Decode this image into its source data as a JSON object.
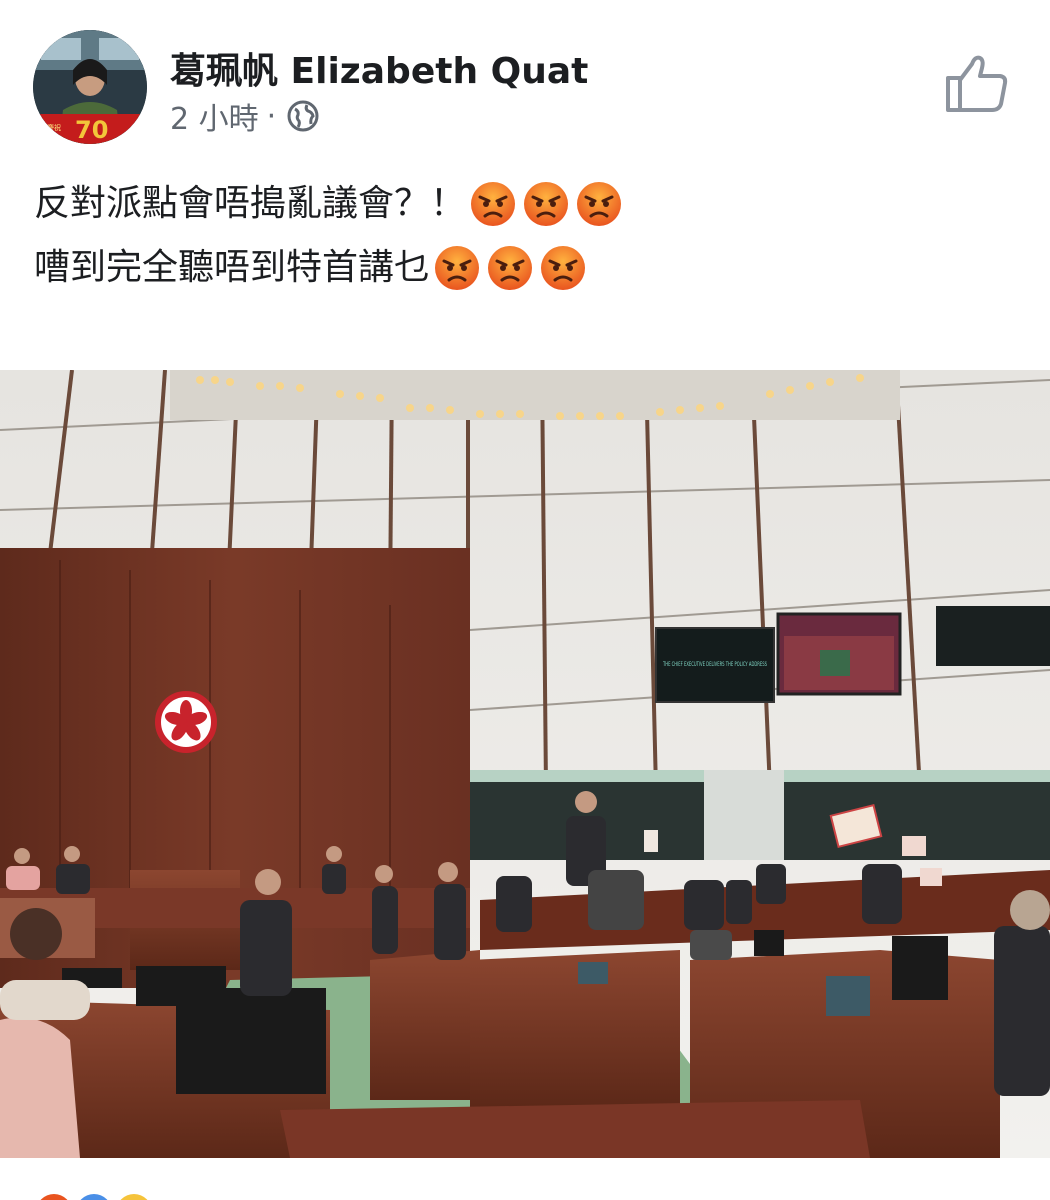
{
  "post": {
    "author_name": "葛珮帆 Elizabeth Quat",
    "time": "2 小時",
    "separator": "·",
    "privacy_icon": "globe-icon",
    "like_icon": "thumbs-up-icon",
    "text_lines": [
      "反對派點會唔搗亂議會？！",
      "嘈到完全聽唔到特首講乜"
    ],
    "emoji": "angry-face-emoji",
    "emoji_counts": [
      3,
      3
    ],
    "avatar_badge": "70"
  },
  "photo": {
    "screen_left_text": "THE CHIEF EXECUTIVE DELIVERS THE POLICY ADDRESS"
  },
  "colors": {
    "text_primary": "#1c1e21",
    "text_secondary": "#606770",
    "icon_gray": "#8d949e"
  }
}
